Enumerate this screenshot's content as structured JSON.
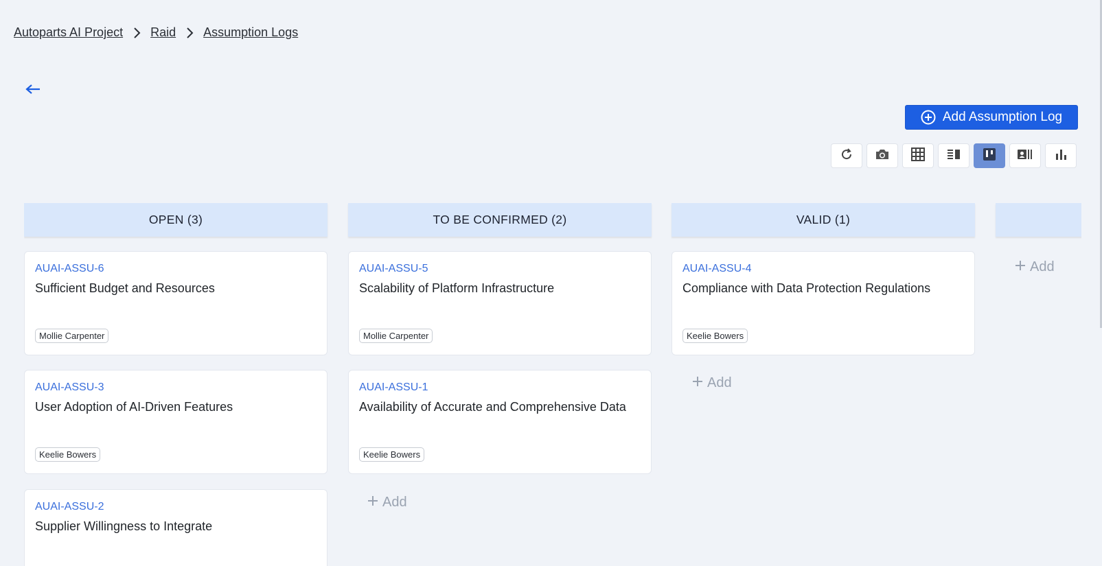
{
  "breadcrumb": {
    "items": [
      "Autoparts AI Project",
      "Raid",
      "Assumption Logs"
    ]
  },
  "header": {
    "back_icon": "arrow-left-icon",
    "add_button_label": "Add Assumption Log"
  },
  "toolbar": {
    "buttons": [
      {
        "icon": "refresh-icon",
        "active": false
      },
      {
        "icon": "camera-icon",
        "active": false
      },
      {
        "icon": "table-grid-icon",
        "active": false
      },
      {
        "icon": "list-detail-icon",
        "active": false
      },
      {
        "icon": "kanban-icon",
        "active": true
      },
      {
        "icon": "card-view-icon",
        "active": false
      },
      {
        "icon": "bar-chart-icon",
        "active": false
      }
    ]
  },
  "colors": {
    "accent": "#1d5fe2",
    "link": "#3a6fdc",
    "column_header": "#d9e7fb",
    "background": "#f0f3f8"
  },
  "board": {
    "columns": [
      {
        "title": "OPEN (3)",
        "cards": [
          {
            "id": "AUAI-ASSU-6",
            "title": "Sufficient Budget and Resources",
            "owner": "Mollie Carpenter"
          },
          {
            "id": "AUAI-ASSU-3",
            "title": "User Adoption of AI-Driven Features",
            "owner": "Keelie Bowers"
          },
          {
            "id": "AUAI-ASSU-2",
            "title": "Supplier Willingness to Integrate",
            "owner": ""
          }
        ]
      },
      {
        "title": "TO BE CONFIRMED (2)",
        "cards": [
          {
            "id": "AUAI-ASSU-5",
            "title": "Scalability of Platform Infrastructure",
            "owner": "Mollie Carpenter"
          },
          {
            "id": "AUAI-ASSU-1",
            "title": "Availability of Accurate and Comprehensive Data",
            "owner": "Keelie Bowers"
          }
        ],
        "add_label": "Add"
      },
      {
        "title": "VALID (1)",
        "cards": [
          {
            "id": "AUAI-ASSU-4",
            "title": "Compliance with Data Protection Regulations",
            "owner": "Keelie Bowers"
          }
        ],
        "add_label": "Add"
      },
      {
        "title": "",
        "cards": [],
        "add_label": "Add"
      }
    ]
  }
}
